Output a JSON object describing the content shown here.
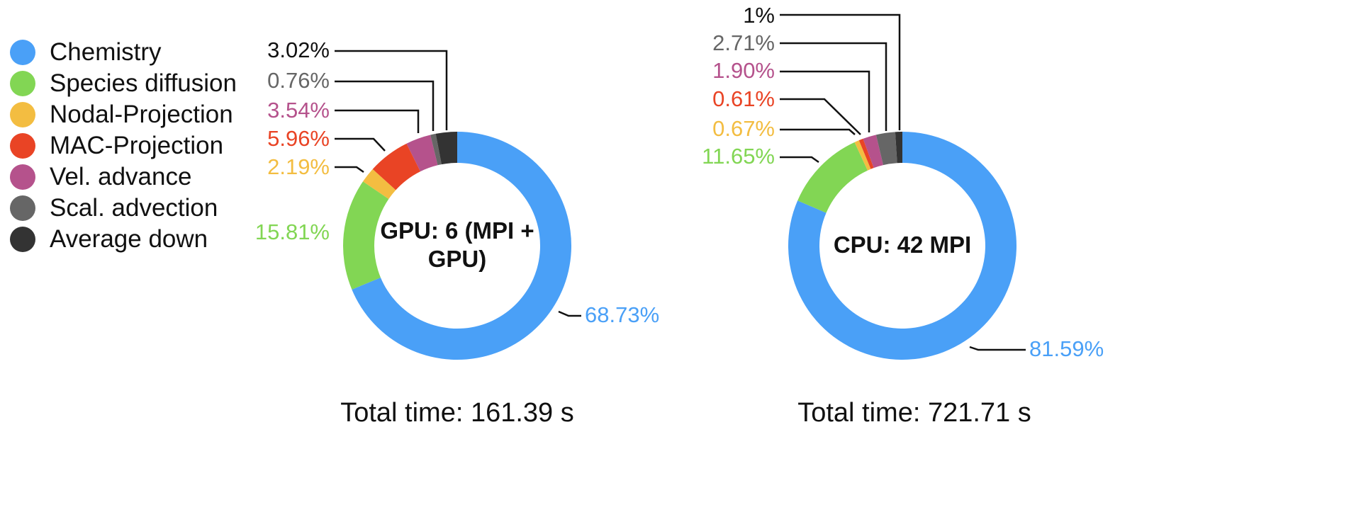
{
  "legend": {
    "items": [
      {
        "label": "Chemistry",
        "color": "#4aa0f7"
      },
      {
        "label": "Species diffusion",
        "color": "#82d654"
      },
      {
        "label": "Nodal-Projection",
        "color": "#f3bd41"
      },
      {
        "label": "MAC-Projection",
        "color": "#e94425"
      },
      {
        "label": "Vel. advance",
        "color": "#b5528c"
      },
      {
        "label": "Scal. advection",
        "color": "#666666"
      },
      {
        "label": "Average down",
        "color": "#333333"
      }
    ]
  },
  "chart_data": [
    {
      "type": "pie",
      "donut": true,
      "center_label": "GPU: 6 (MPI + GPU)",
      "total_label": "Total time: 161.39 s",
      "categories": [
        "Chemistry",
        "Species diffusion",
        "Nodal-Projection",
        "MAC-Projection",
        "Vel. advance",
        "Scal. advection",
        "Average down"
      ],
      "values": [
        68.73,
        15.81,
        2.19,
        5.96,
        3.54,
        0.76,
        3.02
      ],
      "labels": [
        "68.73%",
        "15.81%",
        "2.19%",
        "5.96%",
        "3.54%",
        "0.76%",
        "3.02%"
      ]
    },
    {
      "type": "pie",
      "donut": true,
      "center_label": "CPU: 42 MPI",
      "total_label": "Total time: 721.71 s",
      "categories": [
        "Chemistry",
        "Species diffusion",
        "Nodal-Projection",
        "MAC-Projection",
        "Vel. advance",
        "Scal. advection",
        "Average down"
      ],
      "values": [
        81.59,
        11.65,
        0.67,
        0.61,
        1.9,
        2.71,
        1
      ],
      "labels": [
        "81.59%",
        "11.65%",
        "0.67%",
        "0.61%",
        "1.90%",
        "2.71%",
        "1%"
      ]
    }
  ]
}
